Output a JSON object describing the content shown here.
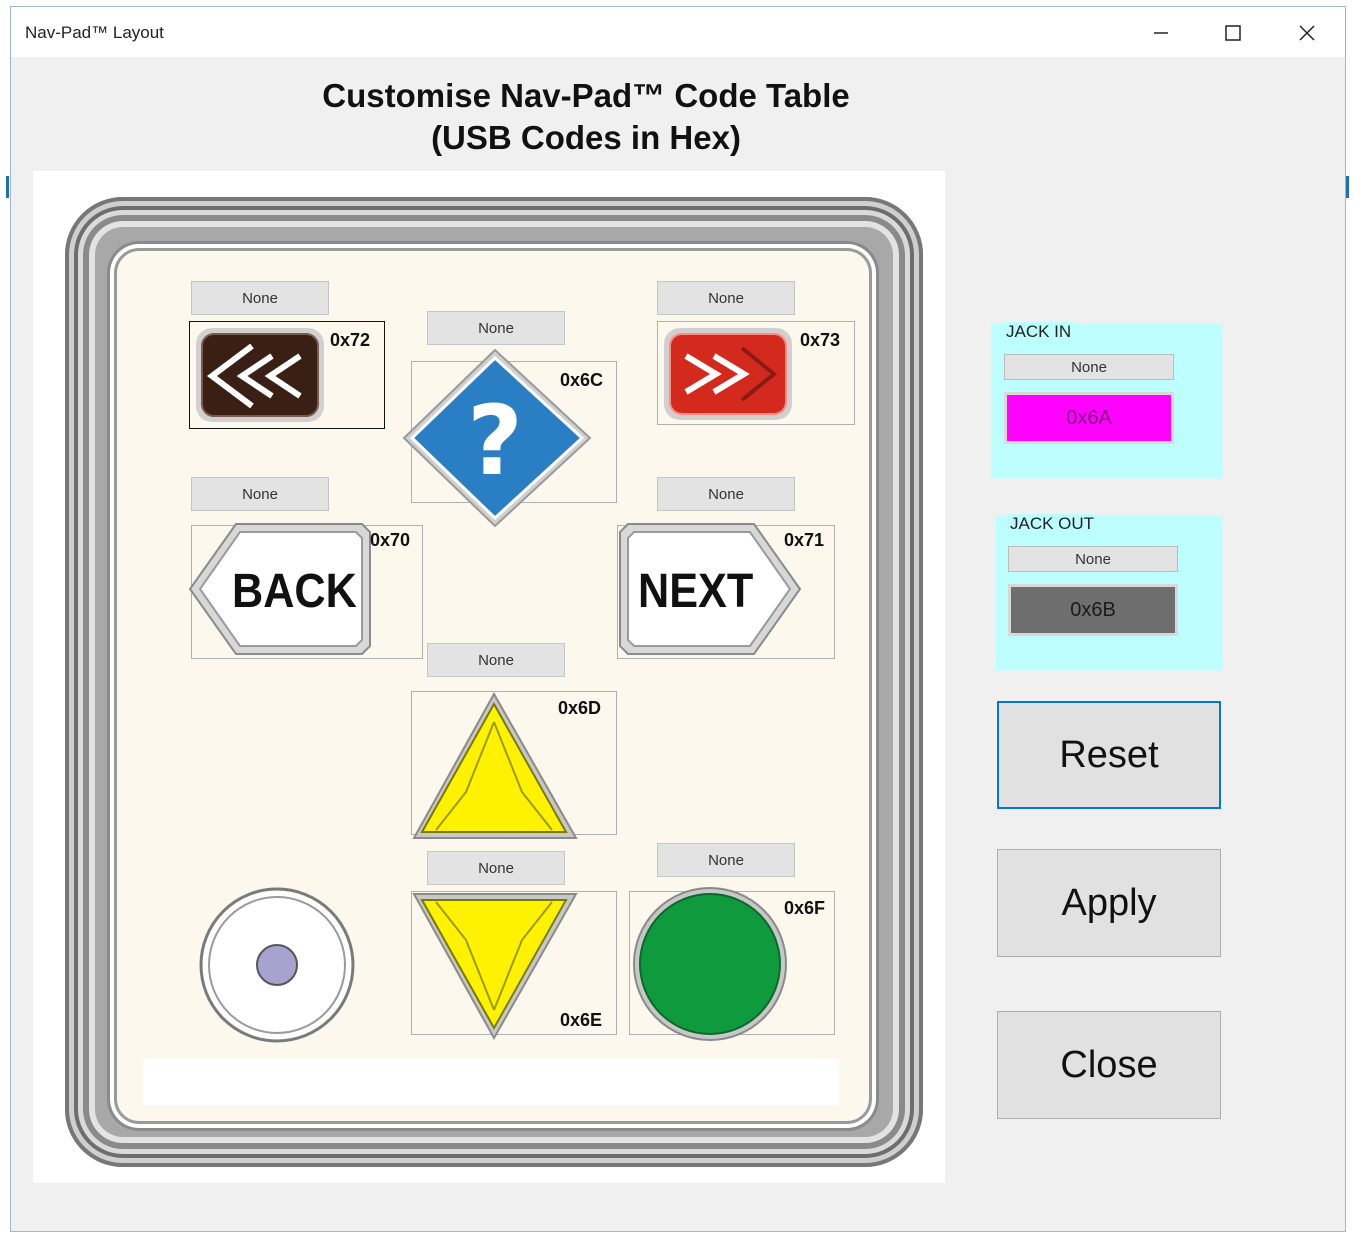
{
  "window": {
    "title": "Nav-Pad™ Layout"
  },
  "heading": {
    "line1": "Customise Nav-Pad™ Code Table",
    "line2": "(USB Codes in Hex)"
  },
  "keys": {
    "rewind": {
      "modifier": "None",
      "code": "0x72",
      "icon": "rewind-icon",
      "color": "#3a1f14"
    },
    "help": {
      "modifier": "None",
      "code": "0x6C",
      "icon": "question-mark-icon",
      "color": "#2a7fc4"
    },
    "forward": {
      "modifier": "None",
      "code": "0x73",
      "icon": "fast-forward-icon",
      "color": "#d42a1e"
    },
    "back": {
      "modifier": "None",
      "code": "0x70",
      "label": "BACK"
    },
    "next": {
      "modifier": "None",
      "code": "0x71",
      "label": "NEXT"
    },
    "up": {
      "modifier": "None",
      "code": "0x6D",
      "icon": "up-triangle-icon",
      "color": "#fff200"
    },
    "down": {
      "modifier": "None",
      "code": "0x6E",
      "icon": "down-triangle-icon",
      "color": "#fff200"
    },
    "select": {
      "modifier": "None",
      "code": "0x6F",
      "icon": "green-circle-icon",
      "color": "#109a3e"
    }
  },
  "jack_in": {
    "label": "JACK IN",
    "modifier": "None",
    "code": "0x6A",
    "color": "#ff00ff"
  },
  "jack_out": {
    "label": "JACK OUT",
    "modifier": "None",
    "code": "0x6B",
    "color": "#6e6e6e"
  },
  "buttons": {
    "reset": "Reset",
    "apply": "Apply",
    "close": "Close"
  },
  "group_bg_color": "#bdffff"
}
